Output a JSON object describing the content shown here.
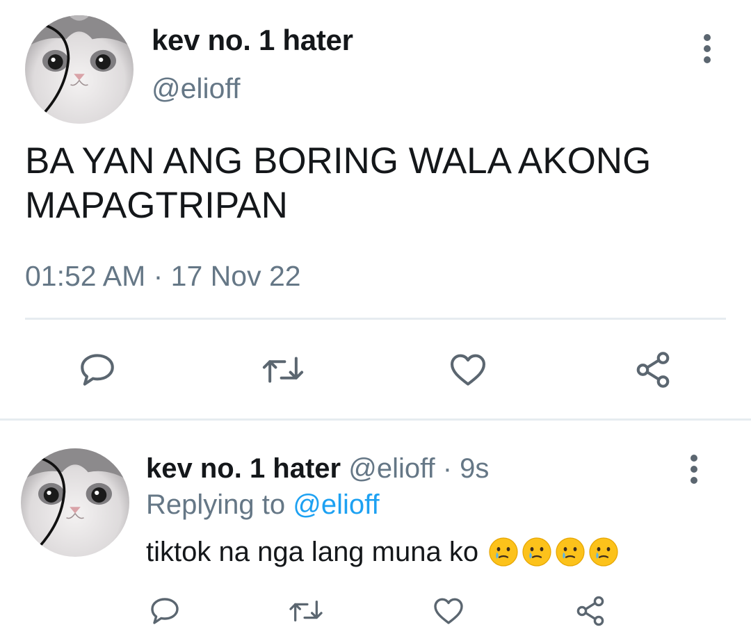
{
  "main_tweet": {
    "display_name": "kev no. 1 hater",
    "handle": "@elioff",
    "text": "BA YAN ANG BORING WALA AKONG MAPAGTRIPAN",
    "timestamp": "01:52 AM · 17 Nov 22",
    "actions": [
      "reply-icon",
      "retweet-icon",
      "like-icon",
      "share-icon"
    ]
  },
  "reply_tweet": {
    "display_name": "kev no. 1 hater",
    "handle": "@elioff",
    "separator": " · ",
    "time": "9s",
    "replying_label": "Replying to ",
    "replying_to": "@elioff",
    "text": "tiktok na nga lang muna ko",
    "emojis": [
      "face-holding-back-tears-icon",
      "face-holding-back-tears-icon",
      "face-holding-back-tears-icon",
      "face-holding-back-tears-icon"
    ],
    "actions": [
      "reply-icon",
      "retweet-icon",
      "like-icon",
      "share-icon"
    ]
  },
  "colors": {
    "text_primary": "#14171a",
    "text_secondary": "#657786",
    "link": "#1da1f2",
    "icon": "#5b6670",
    "divider": "#e6ecf0"
  }
}
